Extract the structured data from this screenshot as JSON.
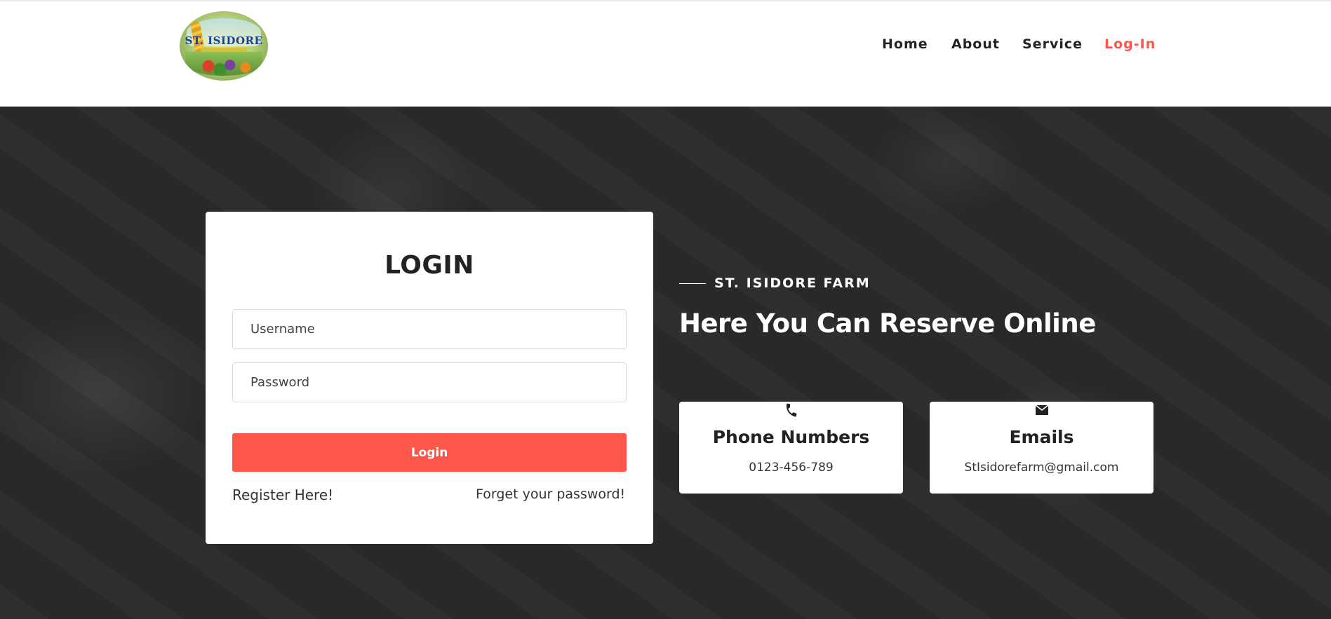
{
  "header": {
    "logo": {
      "text": "ST. ISIDORE",
      "icon": "farm-logo"
    },
    "nav": [
      {
        "label": "Home",
        "active": false
      },
      {
        "label": "About",
        "active": false
      },
      {
        "label": "Service",
        "active": false
      },
      {
        "label": "Log-In",
        "active": true
      }
    ]
  },
  "login": {
    "title": "LOGIN",
    "username_placeholder": "Username",
    "password_placeholder": "Password",
    "submit_label": "Login",
    "register_link": "Register Here!",
    "forgot_link": "Forget your password!"
  },
  "hero": {
    "kicker": "ST. ISIDORE FARM",
    "headline": "Here You Can Reserve Online"
  },
  "contacts": [
    {
      "icon": "phone-icon",
      "title": "Phone Numbers",
      "value": "0123-456-789"
    },
    {
      "icon": "envelope-icon",
      "title": "Emails",
      "value": "StIsidorefarm@gmail.com"
    }
  ],
  "colors": {
    "accent": "#fc574a",
    "hero_bg": "#2b2a29",
    "text_dark": "#222222"
  }
}
